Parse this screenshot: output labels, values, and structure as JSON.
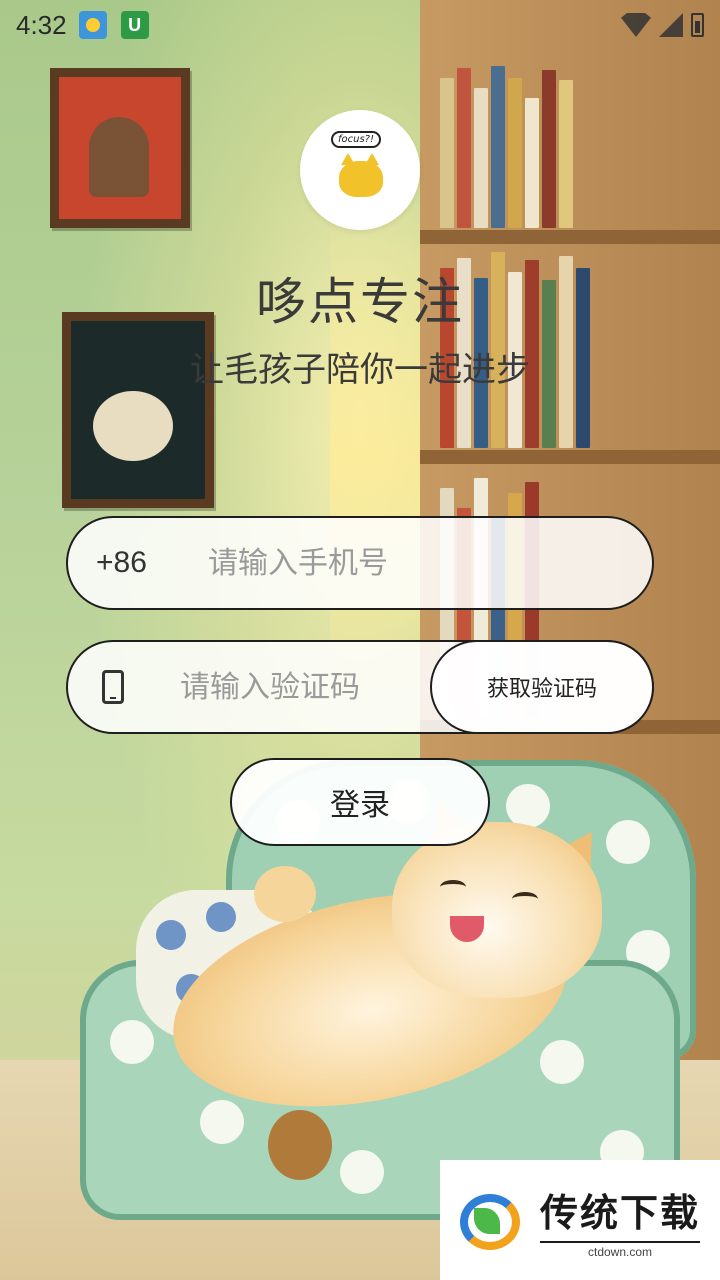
{
  "status_bar": {
    "time": "4:32",
    "notifications": [
      "weather-icon",
      "u-app-icon"
    ],
    "system_icons": [
      "wifi-icon",
      "signal-icon",
      "battery-charging-icon"
    ]
  },
  "header": {
    "logo_bubble_text": "focus?!",
    "title": "哆点专注",
    "slogan": "让毛孩子陪你一起进步"
  },
  "form": {
    "country_code": "+86",
    "phone_placeholder": "请输入手机号",
    "code_placeholder": "请输入验证码",
    "get_code_label": "获取验证码",
    "login_label": "登录"
  },
  "watermark": {
    "title": "传统下载",
    "url": "ctdown.com"
  },
  "colors": {
    "border": "#1e1e1e",
    "logo_cat": "#f2c22b",
    "wall_green": "#b7d29a",
    "chair_green": "#a9d6bb"
  }
}
